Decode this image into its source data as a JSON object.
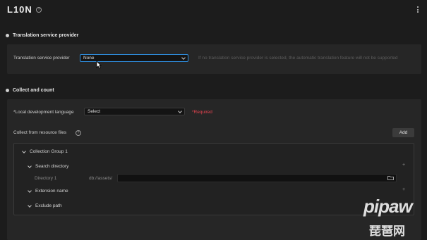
{
  "app": {
    "title": "L10N",
    "title_help_icon": "help-circle-icon",
    "menu_icon": "kebab-menu-icon"
  },
  "translation_section": {
    "heading": "Translation service provider",
    "field_label": "Translation service provider",
    "select_value": "None",
    "hint": "If no translation service provider is selected, the automatic translation feature will not be supported"
  },
  "collect_section": {
    "heading": "Collect and count",
    "language_label": "*Local development language",
    "language_value": "Select",
    "required_text": "*Required",
    "resource_label": "Collect from resource files",
    "resource_help_icon": "help-circle-icon",
    "add_button": "Add",
    "tree": {
      "group_label": "Collection Group 1",
      "search_directory_label": "Search directory",
      "directory_label": "Directory 1",
      "directory_prefix": "db://assets/",
      "directory_value": "",
      "folder_icon": "folder-open-icon",
      "extension_name_label": "Extension name",
      "exclude_path_label": "Exclude path",
      "add_icon": "plus-icon"
    }
  },
  "watermark": {
    "brand": "pipaw",
    "cn": "琵琶网"
  },
  "colors": {
    "background": "#1c1c1c",
    "panel": "#262626",
    "focus": "#2f8fe0",
    "required": "#e5434f"
  }
}
